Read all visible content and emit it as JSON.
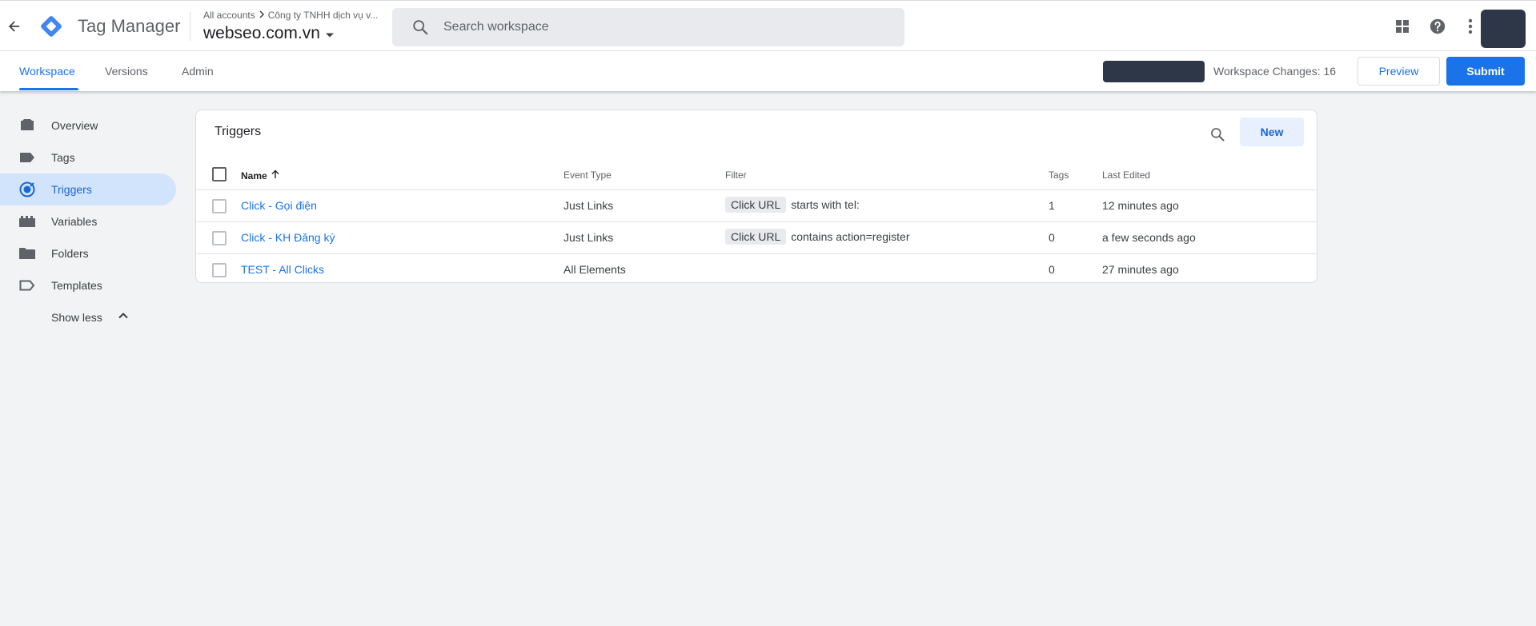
{
  "app": {
    "product_name": "Tag Manager",
    "breadcrumb_root": "All accounts",
    "breadcrumb_account": "Công ty TNHH dịch vụ v...",
    "container_name": "webseo.com.vn"
  },
  "search": {
    "placeholder": "Search workspace"
  },
  "tabs": [
    {
      "label": "Workspace",
      "active": true
    },
    {
      "label": "Versions",
      "active": false
    },
    {
      "label": "Admin",
      "active": false
    }
  ],
  "workspace": {
    "changes_label": "Workspace Changes: 16",
    "preview_label": "Preview",
    "submit_label": "Submit"
  },
  "sidebar": {
    "items": [
      {
        "label": "Overview",
        "icon": "overview-icon"
      },
      {
        "label": "Tags",
        "icon": "tag-icon"
      },
      {
        "label": "Triggers",
        "icon": "trigger-icon",
        "active": true
      },
      {
        "label": "Variables",
        "icon": "variables-icon"
      },
      {
        "label": "Folders",
        "icon": "folder-icon"
      },
      {
        "label": "Templates",
        "icon": "template-icon"
      }
    ],
    "show_less_label": "Show less"
  },
  "triggers": {
    "title": "Triggers",
    "new_label": "New",
    "columns": {
      "name": "Name",
      "event_type": "Event Type",
      "filter": "Filter",
      "tags": "Tags",
      "last_edited": "Last Edited"
    },
    "rows": [
      {
        "name": "Click - Gọi điện",
        "event_type": "Just Links",
        "filter_var": "Click URL",
        "filter_cond": "starts with tel:",
        "tags": "1",
        "last_edited": "12 minutes ago"
      },
      {
        "name": "Click - KH Đăng ký",
        "event_type": "Just Links",
        "filter_var": "Click URL",
        "filter_cond": "contains action=register",
        "tags": "0",
        "last_edited": "a few seconds ago"
      },
      {
        "name": "TEST - All Clicks",
        "event_type": "All Elements",
        "filter_var": "",
        "filter_cond": "",
        "tags": "0",
        "last_edited": "27 minutes ago"
      }
    ]
  },
  "colors": {
    "accent": "#1a73e8",
    "active_nav_bg": "#d2e3fc",
    "page_bg": "#f1f3f4"
  }
}
